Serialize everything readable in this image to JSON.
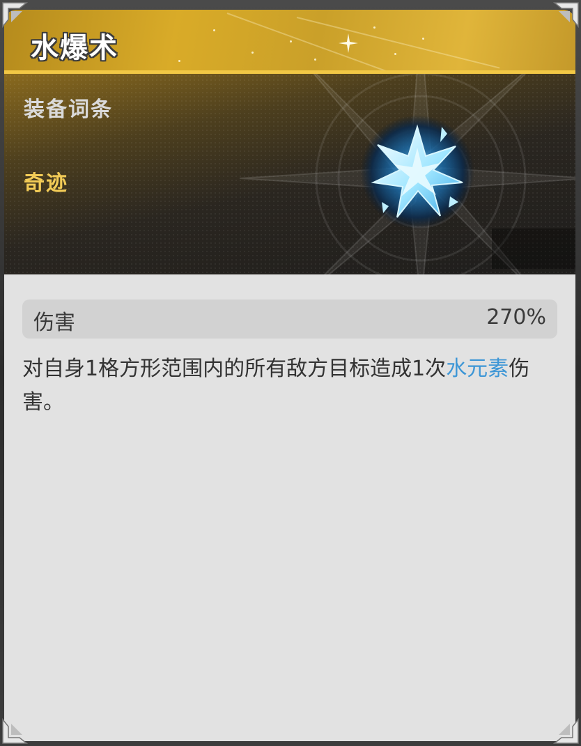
{
  "skill": {
    "name": "水爆术",
    "category_label": "装备词条",
    "rarity": "奇迹",
    "icon": "ice-burst-icon"
  },
  "stats": [
    {
      "label": "伤害",
      "value": "270%"
    }
  ],
  "description": {
    "prefix": "对自身1格方形范围内的所有敌方目标造成1次",
    "highlight": "水元素",
    "suffix": "伤害。"
  },
  "colors": {
    "header_gold": "#d9ab28",
    "rarity_text": "#f3cc57",
    "element_highlight": "#3d96d6",
    "body_bg": "#e2e2e2"
  }
}
